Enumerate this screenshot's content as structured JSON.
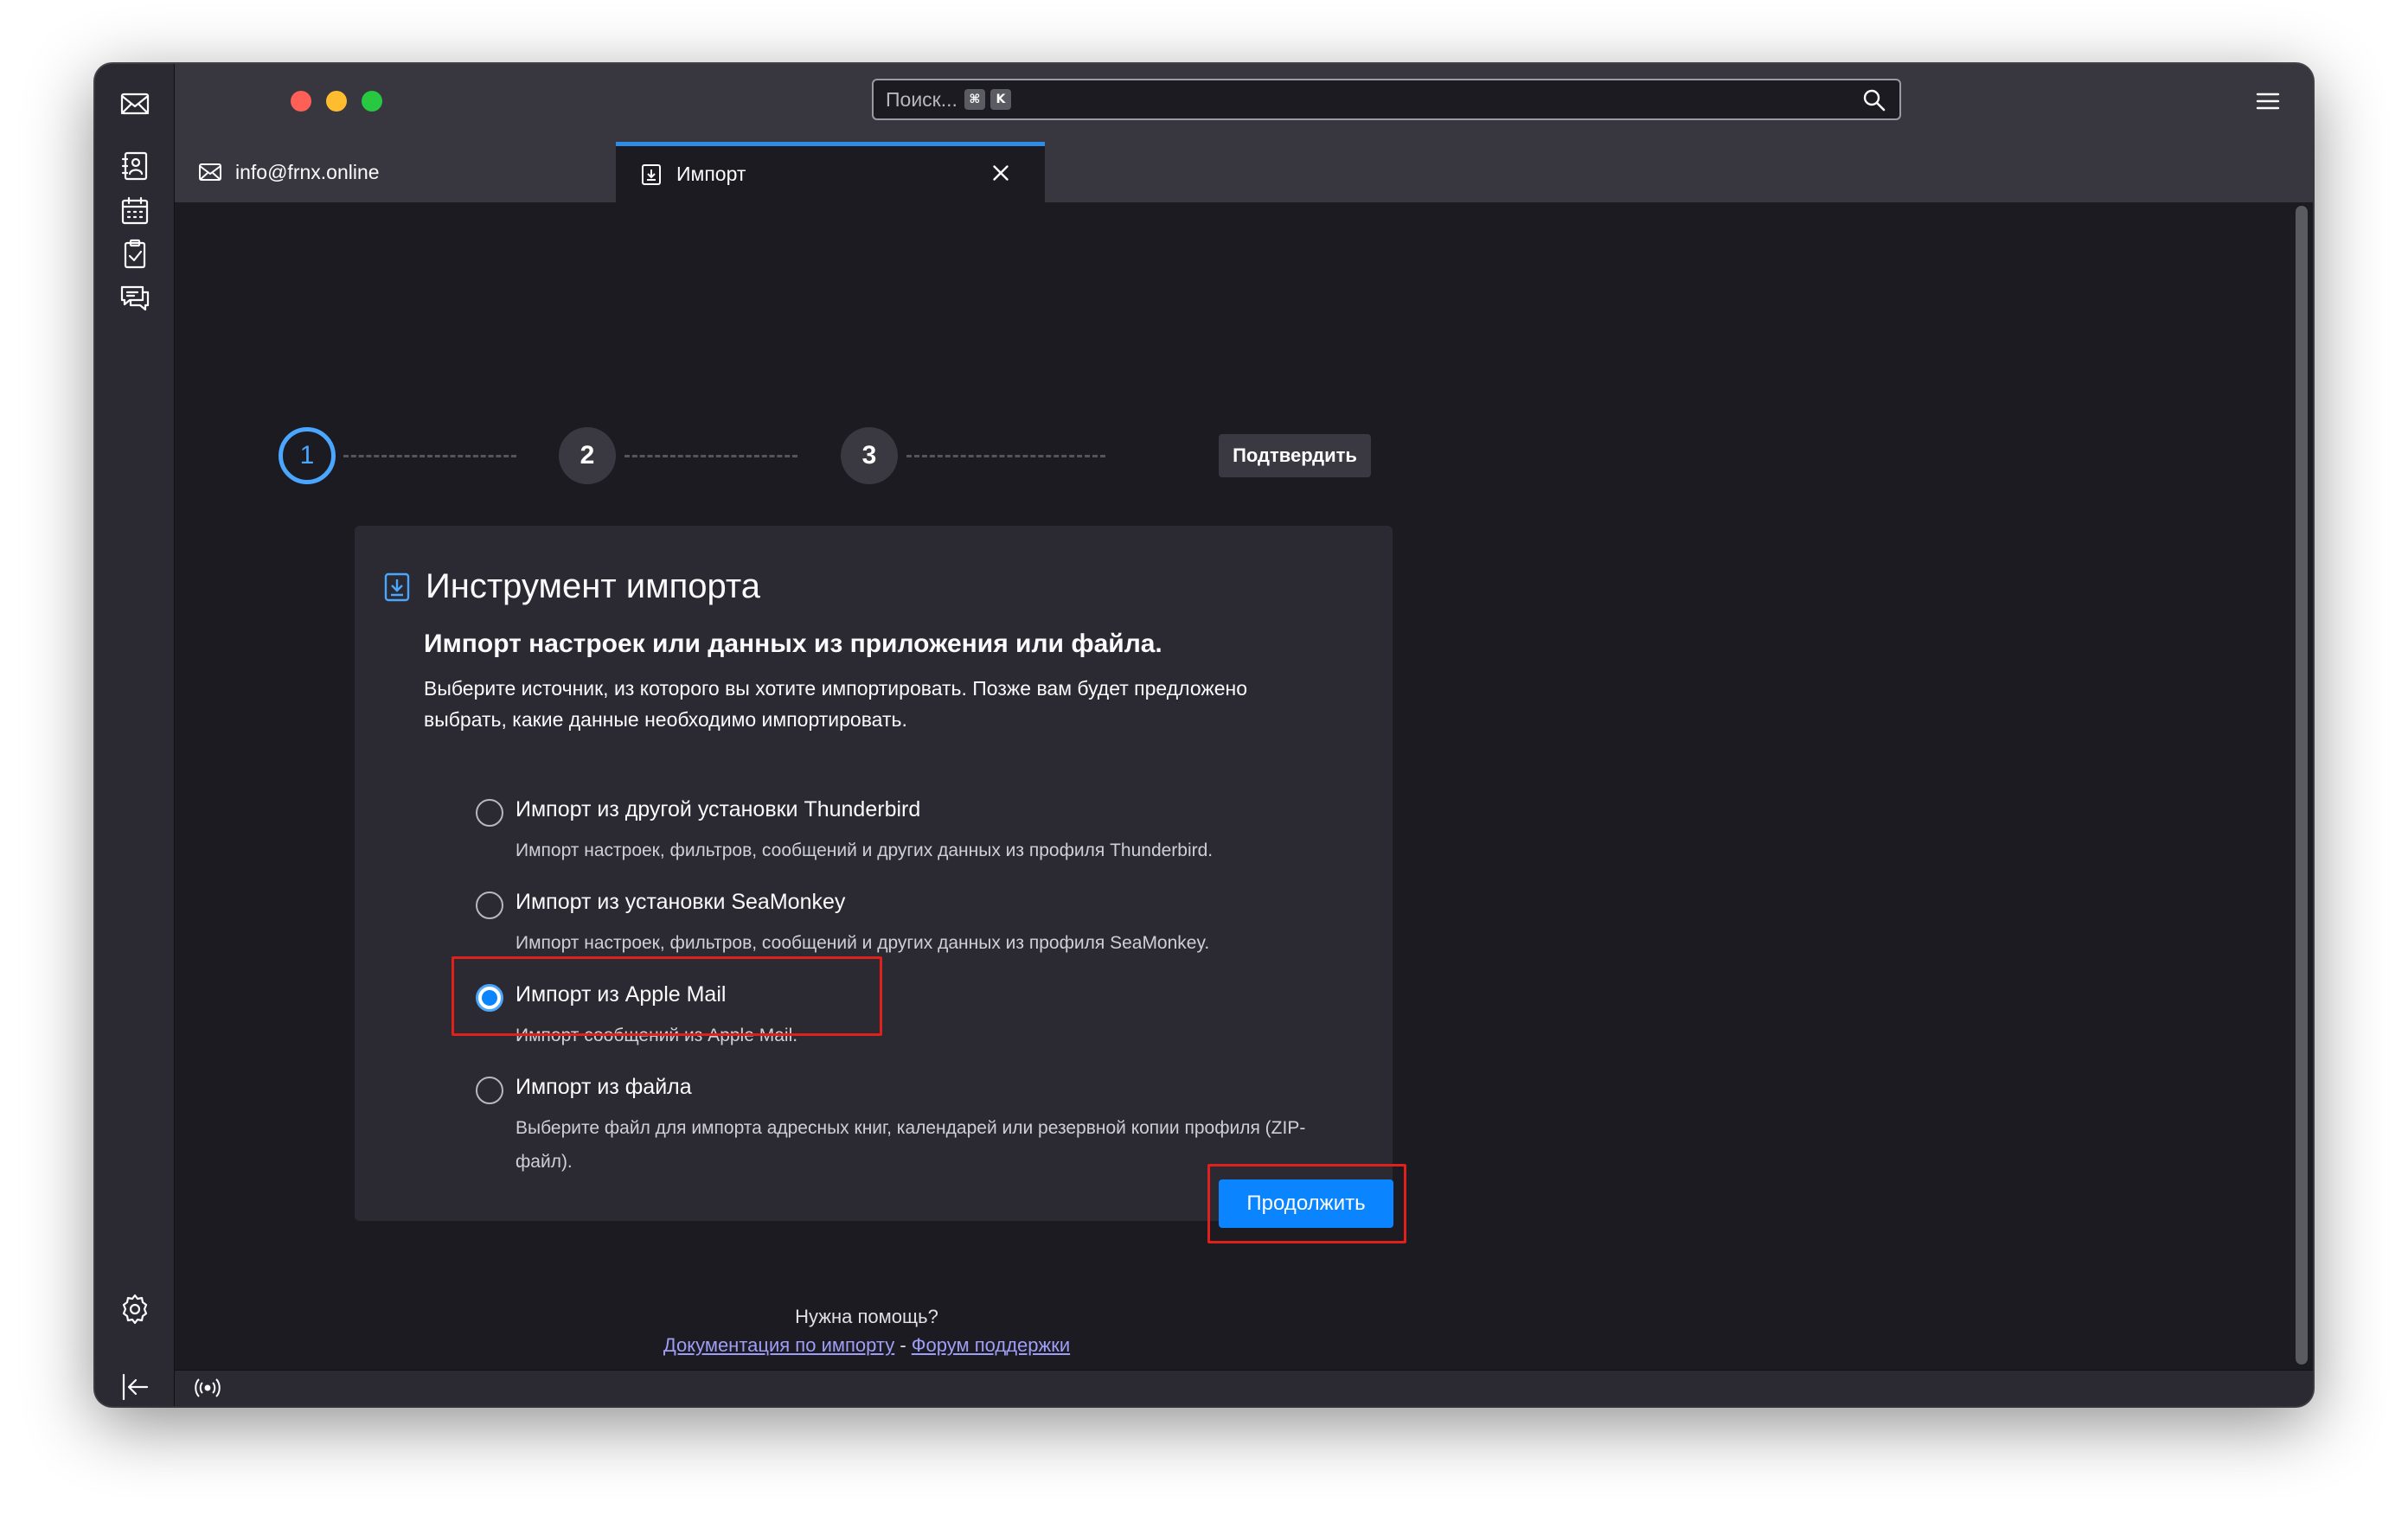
{
  "window": {
    "traffic_colors": [
      "#fe5f57",
      "#febc2e",
      "#28c840"
    ]
  },
  "search": {
    "placeholder": "Поиск...",
    "shortcut_key1": "⌘",
    "shortcut_key2": "K"
  },
  "spaces": [
    "mail-icon",
    "address-book-icon",
    "calendar-icon",
    "tasks-icon",
    "chat-icon",
    "settings-icon",
    "collapse-icon"
  ],
  "tabs": [
    {
      "label": "info@frnx.online",
      "icon": "mail-tab-icon"
    },
    {
      "label": "Импорт",
      "icon": "import-icon",
      "active": true
    }
  ],
  "stepper": {
    "steps": [
      "1",
      "2",
      "3"
    ],
    "confirm_label": "Подтвердить"
  },
  "card": {
    "title": "Инструмент импорта",
    "subtitle": "Импорт настроек или данных из приложения или файла.",
    "description": "Выберите источник, из которого вы хотите импортировать. Позже вам будет предложено выбрать, какие данные необходимо импортировать.",
    "options": [
      {
        "label": "Импорт из другой установки Thunderbird",
        "desc": "Импорт настроек, фильтров, сообщений и других данных из профиля Thunderbird.",
        "checked": false
      },
      {
        "label": "Импорт из установки SeaMonkey",
        "desc": "Импорт настроек, фильтров, сообщений и других данных из профиля SeaMonkey.",
        "checked": false
      },
      {
        "label": "Импорт из Apple Mail",
        "desc": "Импорт сообщений из Apple Mail.",
        "checked": true
      },
      {
        "label": "Импорт из файла",
        "desc": "Выберите файл для импорта адресных книг, календарей или резервной копии профиля (ZIP-файл).",
        "checked": false
      }
    ]
  },
  "continue_label": "Продолжить",
  "help": {
    "question": "Нужна помощь?",
    "docs_link": "Документация по импорту",
    "separator": " - ",
    "forum_link": "Форум поддержки"
  },
  "colors": {
    "accent": "#0a84ff",
    "highlight": "#e0201b"
  }
}
